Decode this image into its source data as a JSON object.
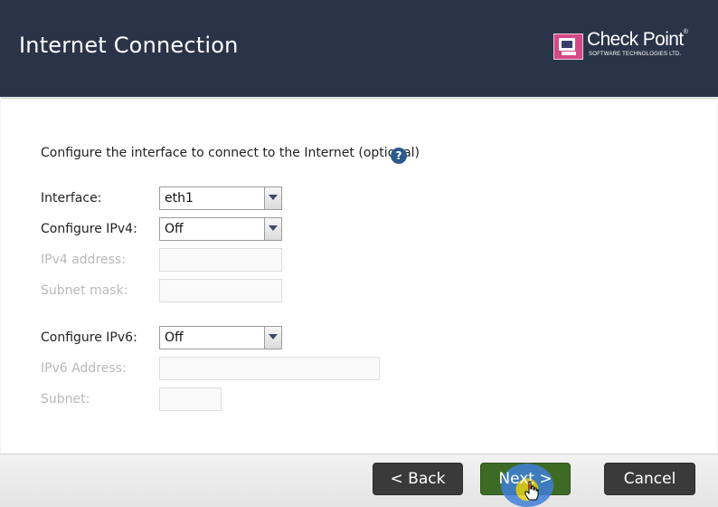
{
  "header": {
    "title": "Internet Connection",
    "logo": {
      "name": "Check Point",
      "registered": "®",
      "tagline": "SOFTWARE TECHNOLOGIES LTD."
    }
  },
  "form": {
    "intro": "Configure the interface to connect to the Internet (optional)",
    "help_icon": "?",
    "interface": {
      "label": "Interface:",
      "value": "eth1"
    },
    "configure_ipv4": {
      "label": "Configure IPv4:",
      "value": "Off"
    },
    "ipv4_address": {
      "label": "IPv4 address:",
      "value": ""
    },
    "subnet_mask": {
      "label": "Subnet mask:",
      "value": ""
    },
    "configure_ipv6": {
      "label": "Configure IPv6:",
      "value": "Off"
    },
    "ipv6_address": {
      "label": "IPv6 Address:",
      "value": ""
    },
    "subnet": {
      "label": "Subnet:",
      "value": ""
    }
  },
  "footer": {
    "back_label": "< Back",
    "next_label": "Next >",
    "cancel_label": "Cancel"
  },
  "colors": {
    "header_bg": "#2a3449",
    "button_bg": "#3a3a3a",
    "next_button_bg": "#3d6b25",
    "disabled_text": "#b9b9b9",
    "help_icon": "#2d5a8c"
  }
}
